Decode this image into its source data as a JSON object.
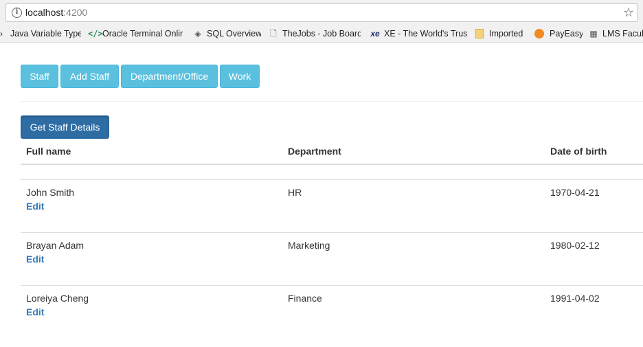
{
  "browser": {
    "url_host": "localhost",
    "url_port": ":4200",
    "bookmarks": [
      {
        "label": "Java Variable Types",
        "icon": "arrow-icon"
      },
      {
        "label": "Oracle Terminal Onlir",
        "icon": "code-icon"
      },
      {
        "label": "SQL Overview",
        "icon": "diamond-icon"
      },
      {
        "label": "TheJobs - Job Board",
        "icon": "page-icon"
      },
      {
        "label": "XE - The World's Trus",
        "icon": "xe-icon"
      },
      {
        "label": "Imported",
        "icon": "folder-icon"
      },
      {
        "label": "PayEasy",
        "icon": "payeasy-icon"
      },
      {
        "label": "LMS Facult",
        "icon": "lms-icon"
      }
    ]
  },
  "nav": {
    "items": [
      {
        "label": "Staff"
      },
      {
        "label": "Add Staff"
      },
      {
        "label": "Department/Office"
      },
      {
        "label": "Work"
      }
    ],
    "color": "#5bc0de"
  },
  "actions": {
    "get_details_label": "Get Staff Details",
    "color": "#2e6da4"
  },
  "table": {
    "headers": [
      "Full name",
      "Department",
      "Date of birth"
    ],
    "edit_label": "Edit",
    "link_color": "#337ab7",
    "rows": [
      {
        "name": "John Smith",
        "department": "HR",
        "dob": "1970-04-21"
      },
      {
        "name": "Brayan Adam",
        "department": "Marketing",
        "dob": "1980-02-12"
      },
      {
        "name": "Loreiya Cheng",
        "department": "Finance",
        "dob": "1991-04-02"
      }
    ]
  }
}
